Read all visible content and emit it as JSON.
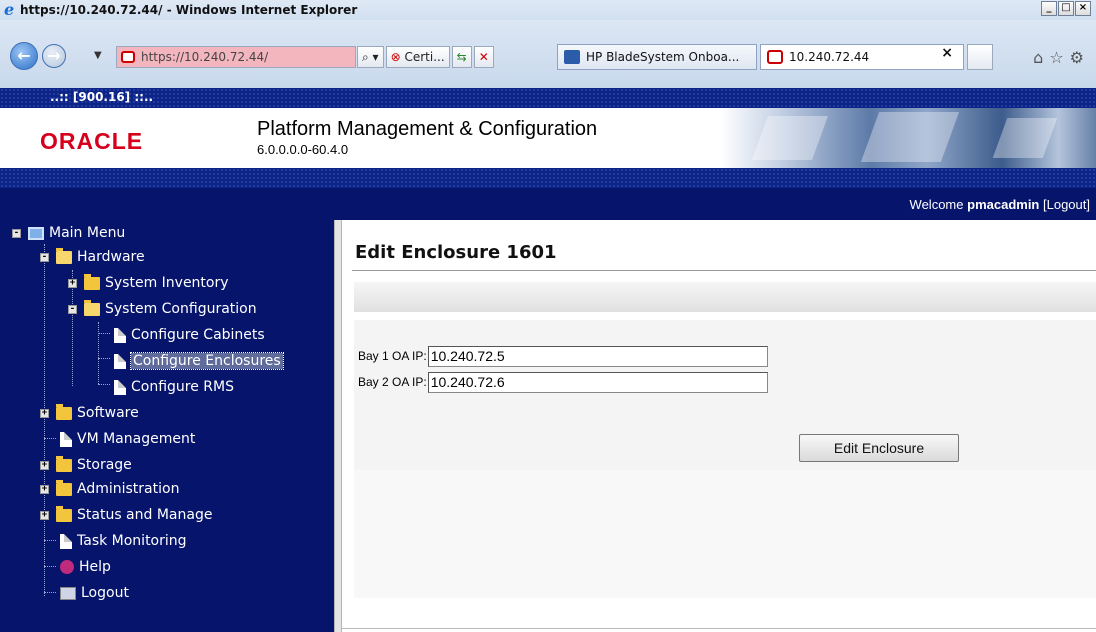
{
  "browser": {
    "window_title": "https://10.240.72.44/ - Windows Internet Explorer",
    "address": "https://10.240.72.44/",
    "cert_label": "Certi...",
    "tabs": [
      {
        "label": "HP BladeSystem Onboa...",
        "active": false
      },
      {
        "label": "10.240.72.44",
        "active": true
      }
    ],
    "close_tab_glyph": "×",
    "window_buttons": [
      "_",
      "□",
      "×"
    ]
  },
  "app": {
    "node_label": "..:: [900.16] ::..",
    "logo_text": "ORACLE",
    "title": "Platform Management & Configuration",
    "version": "6.0.0.0.0-60.4.0",
    "welcome_prefix": "Welcome",
    "username": "pmacadmin",
    "logout_link": "[Logout]",
    "brand_color": "#d6001c",
    "nav_color": "#06146c"
  },
  "tree": {
    "main_menu": "Main Menu",
    "hardware": "Hardware",
    "system_inventory": "System Inventory",
    "system_configuration": "System Configuration",
    "configure_cabinets": "Configure Cabinets",
    "configure_enclosures": "Configure Enclosures",
    "configure_rms": "Configure RMS",
    "software": "Software",
    "vm_management": "VM Management",
    "storage": "Storage",
    "administration": "Administration",
    "status_and_manage": "Status and Manage",
    "task_monitoring": "Task Monitoring",
    "help": "Help",
    "logout": "Logout"
  },
  "main": {
    "page_title": "Edit Enclosure 1601",
    "bay1_label": "Bay 1 OA IP:",
    "bay1_value": "10.240.72.5",
    "bay2_label": "Bay 2 OA IP:",
    "bay2_value": "10.240.72.6",
    "submit_label": "Edit Enclosure"
  }
}
